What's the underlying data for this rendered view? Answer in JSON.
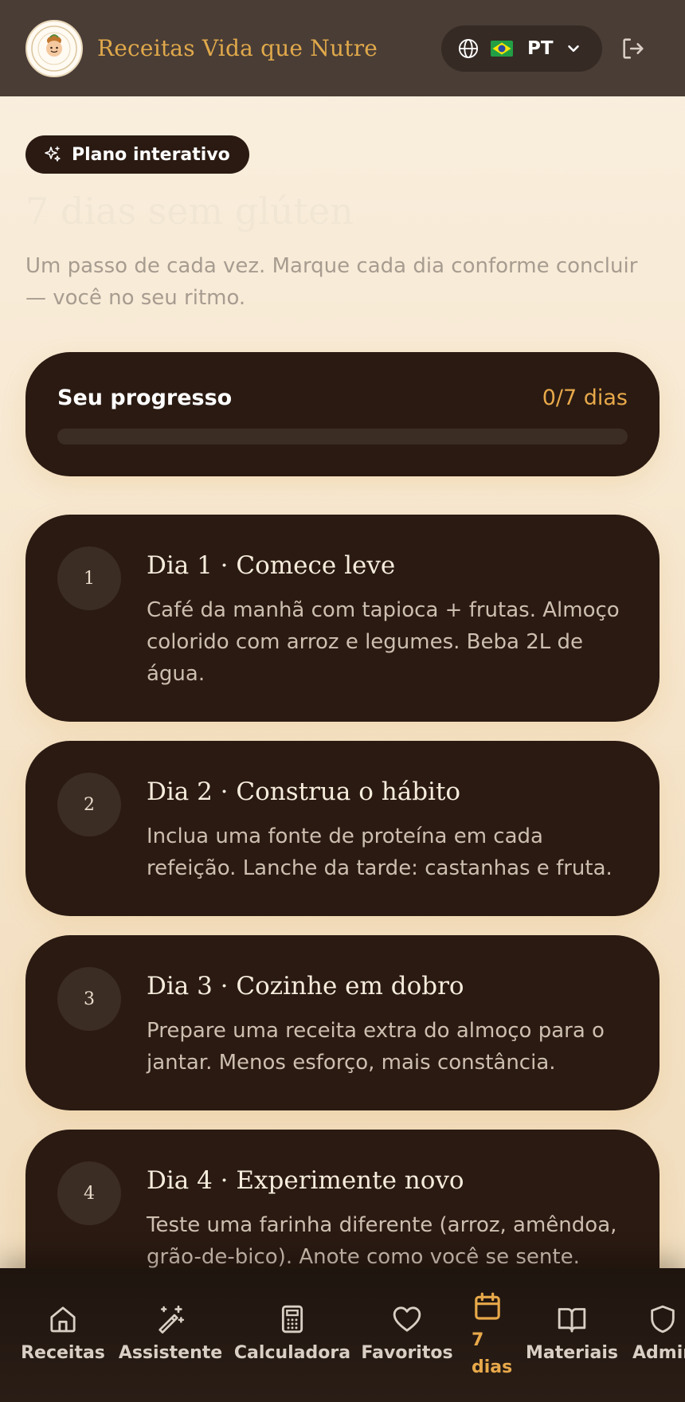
{
  "header": {
    "brand": "Receitas Vida que Nutre",
    "language_code": "PT",
    "flag": "🇧🇷"
  },
  "hero": {
    "badge": "Plano interativo",
    "title": "7 dias sem glúten",
    "subtitle": "Um passo de cada vez. Marque cada dia conforme concluir — você no seu ritmo."
  },
  "progress": {
    "label": "Seu progresso",
    "count_text": "0/7 dias",
    "fraction": 0
  },
  "days": [
    {
      "number": "1",
      "title": "Dia 1 · Comece leve",
      "description": "Café da manhã com tapioca + frutas. Almoço colorido com arroz e legumes. Beba 2L de água."
    },
    {
      "number": "2",
      "title": "Dia 2 · Construa o hábito",
      "description": "Inclua uma fonte de proteína em cada refeição. Lanche da tarde: castanhas e fruta."
    },
    {
      "number": "3",
      "title": "Dia 3 · Cozinhe em dobro",
      "description": "Prepare uma receita extra do almoço para o jantar. Menos esforço, mais constância."
    },
    {
      "number": "4",
      "title": "Dia 4 · Experimente novo",
      "description": "Teste uma farinha diferente (arroz, amêndoa, grão-de-bico). Anote como você se sente."
    }
  ],
  "nav": {
    "items": [
      {
        "label": "Receitas",
        "icon": "home-icon"
      },
      {
        "label": "Assistente",
        "icon": "magic-wand-icon"
      },
      {
        "label": "Calculadora",
        "icon": "calculator-icon"
      },
      {
        "label": "Favoritos",
        "icon": "heart-icon"
      },
      {
        "label": "7 dias",
        "icon": "calendar-icon",
        "active": true
      },
      {
        "label": "Materiais",
        "icon": "book-icon"
      },
      {
        "label": "Admin",
        "icon": "shield-icon"
      }
    ]
  },
  "colors": {
    "accent": "#e8a94a",
    "card": "#2a1a12",
    "header": "#4a3d36"
  }
}
